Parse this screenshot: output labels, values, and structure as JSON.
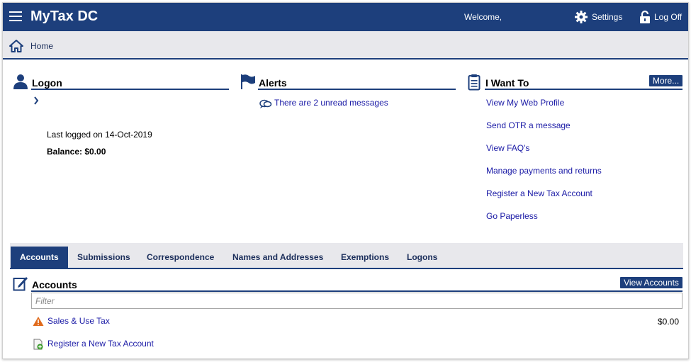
{
  "header": {
    "app_title": "MyTax DC",
    "welcome": "Welcome,",
    "settings_label": "Settings",
    "logoff_label": "Log Off"
  },
  "breadcrumb": {
    "home_label": "Home"
  },
  "logon_panel": {
    "title": "Logon",
    "last_logged": "Last logged on 14-Oct-2019",
    "balance": "Balance: $0.00"
  },
  "alerts_panel": {
    "title": "Alerts",
    "message_link": "There are 2 unread messages"
  },
  "iwant_panel": {
    "title": "I Want To",
    "more_label": "More...",
    "links": [
      "View My Web Profile",
      "Send OTR a message",
      "View FAQ's",
      "Manage payments and returns",
      "Register a New Tax Account",
      "Go Paperless"
    ]
  },
  "tabs": [
    "Accounts",
    "Submissions",
    "Correspondence",
    "Names and Addresses",
    "Exemptions",
    "Logons"
  ],
  "accounts_section": {
    "title": "Accounts",
    "view_accounts_label": "View Accounts",
    "filter_placeholder": "Filter",
    "rows": [
      {
        "name": "Sales & Use Tax",
        "amount": "$0.00"
      }
    ],
    "register_link": "Register a New Tax Account"
  },
  "colors": {
    "primary": "#1d3f7c",
    "link": "#1a1aa6",
    "bar_bg": "#e8e8ec",
    "warning": "#e06a1b"
  },
  "icons": [
    "hamburger-icon",
    "gear-icon",
    "lock-icon",
    "home-icon",
    "user-icon",
    "flag-icon",
    "clipboard-icon",
    "chevron-right-icon",
    "chat-icon",
    "edit-icon",
    "warning-icon",
    "document-add-icon"
  ]
}
